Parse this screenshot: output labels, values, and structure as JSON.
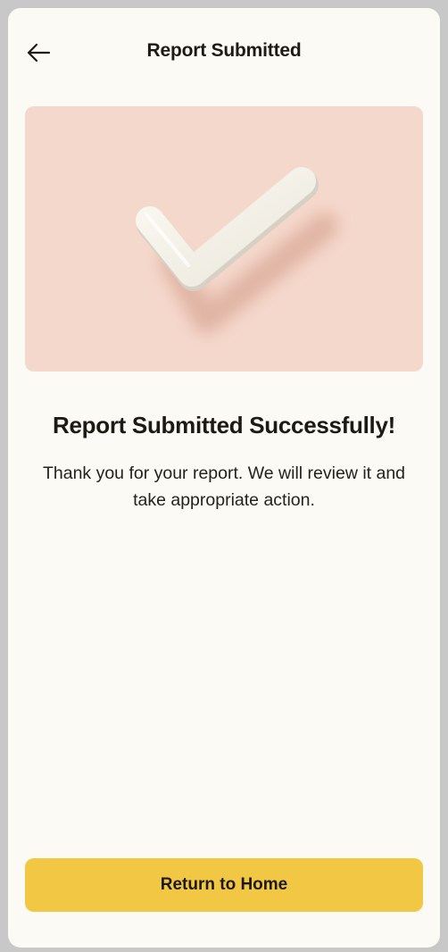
{
  "header": {
    "title": "Report Submitted",
    "back_icon": "arrow-left-icon"
  },
  "hero": {
    "icon": "checkmark-icon",
    "background_color": "#f5d8cc"
  },
  "content": {
    "title": "Report Submitted Successfully!",
    "message": "Thank you for your report. We will review it and take appropriate action."
  },
  "actions": {
    "home_button_label": "Return to Home",
    "button_color": "#f2c744"
  }
}
